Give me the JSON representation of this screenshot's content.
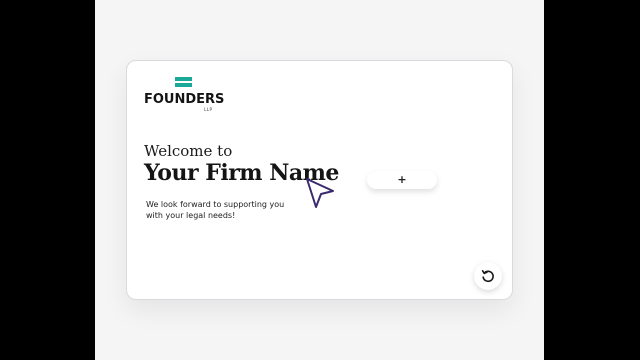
{
  "logo": {
    "name": "FOUNDERS",
    "suffix": "LLP",
    "accent_color": "#1aa999"
  },
  "hero": {
    "welcome": "Welcome to",
    "firm_name": "Your Firm Name",
    "tagline_line1": "We look forward to supporting you",
    "tagline_line2": "with your legal needs!"
  },
  "actions": {
    "add_label": "+",
    "reset_icon": "reset-icon"
  },
  "cursor": {
    "icon": "pointer-arrow-icon",
    "color": "#3a2a6e"
  }
}
